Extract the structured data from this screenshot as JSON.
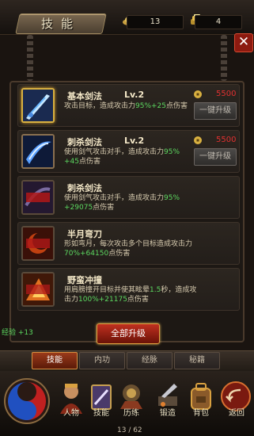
{
  "header": {
    "title": "技能",
    "ingot_count": "13",
    "gold_count": "4"
  },
  "skills": [
    {
      "name": "基本剑法",
      "level": "Lv.2",
      "desc_pre": "攻击目标，造成攻击力",
      "desc_hl": "95%+25",
      "desc_post": "点伤害",
      "cost": "5500",
      "button": "一键升级",
      "state": "upgradable"
    },
    {
      "name": "刺杀剑法",
      "level": "Lv.2",
      "desc_pre": "使用剑气攻击对手，造成攻击力",
      "desc_hl": "95%",
      "desc_hl2": "+45",
      "desc_post": "点伤害",
      "cost": "5500",
      "button": "一键升级",
      "state": "upgradable"
    },
    {
      "name": "刺杀剑法",
      "desc_pre": "使用剑气攻击对手，造成攻击力",
      "desc_hl": "95%",
      "desc_hl2": "+29075",
      "desc_post": "点伤害",
      "state": "locked"
    },
    {
      "name": "半月弯刀",
      "desc_pre": "形如弯月，每次攻击多个目标造成攻击力",
      "desc_hl": "70%+64150",
      "desc_post": "点伤害",
      "state": "locked"
    },
    {
      "name": "野蛮冲撞",
      "desc_pre": "用肩膀撞开目标并使其眩晕",
      "desc_hl": "1.5",
      "desc_mid": "秒，造成攻击力",
      "desc_hl2": "100%+21175",
      "desc_post": "点伤害",
      "state": "locked"
    }
  ],
  "experience": "经验 +13",
  "upgrade_all": "全部升级",
  "tabs": [
    "技能",
    "内功",
    "经脉",
    "秘籍"
  ],
  "nav": [
    "人物",
    "技能",
    "历练",
    "锻造",
    "背包"
  ],
  "return_label": "返回",
  "page": "13 / 62",
  "colors": {
    "accent_red": "#c03020",
    "highlight_green": "#5cd860",
    "cost_red": "#e03030",
    "gold": "#d8b040"
  },
  "icons": [
    "ingot-icon",
    "gold-icon",
    "close-icon",
    "coin-icon",
    "sword-icon",
    "orb-icon",
    "return-icon"
  ]
}
